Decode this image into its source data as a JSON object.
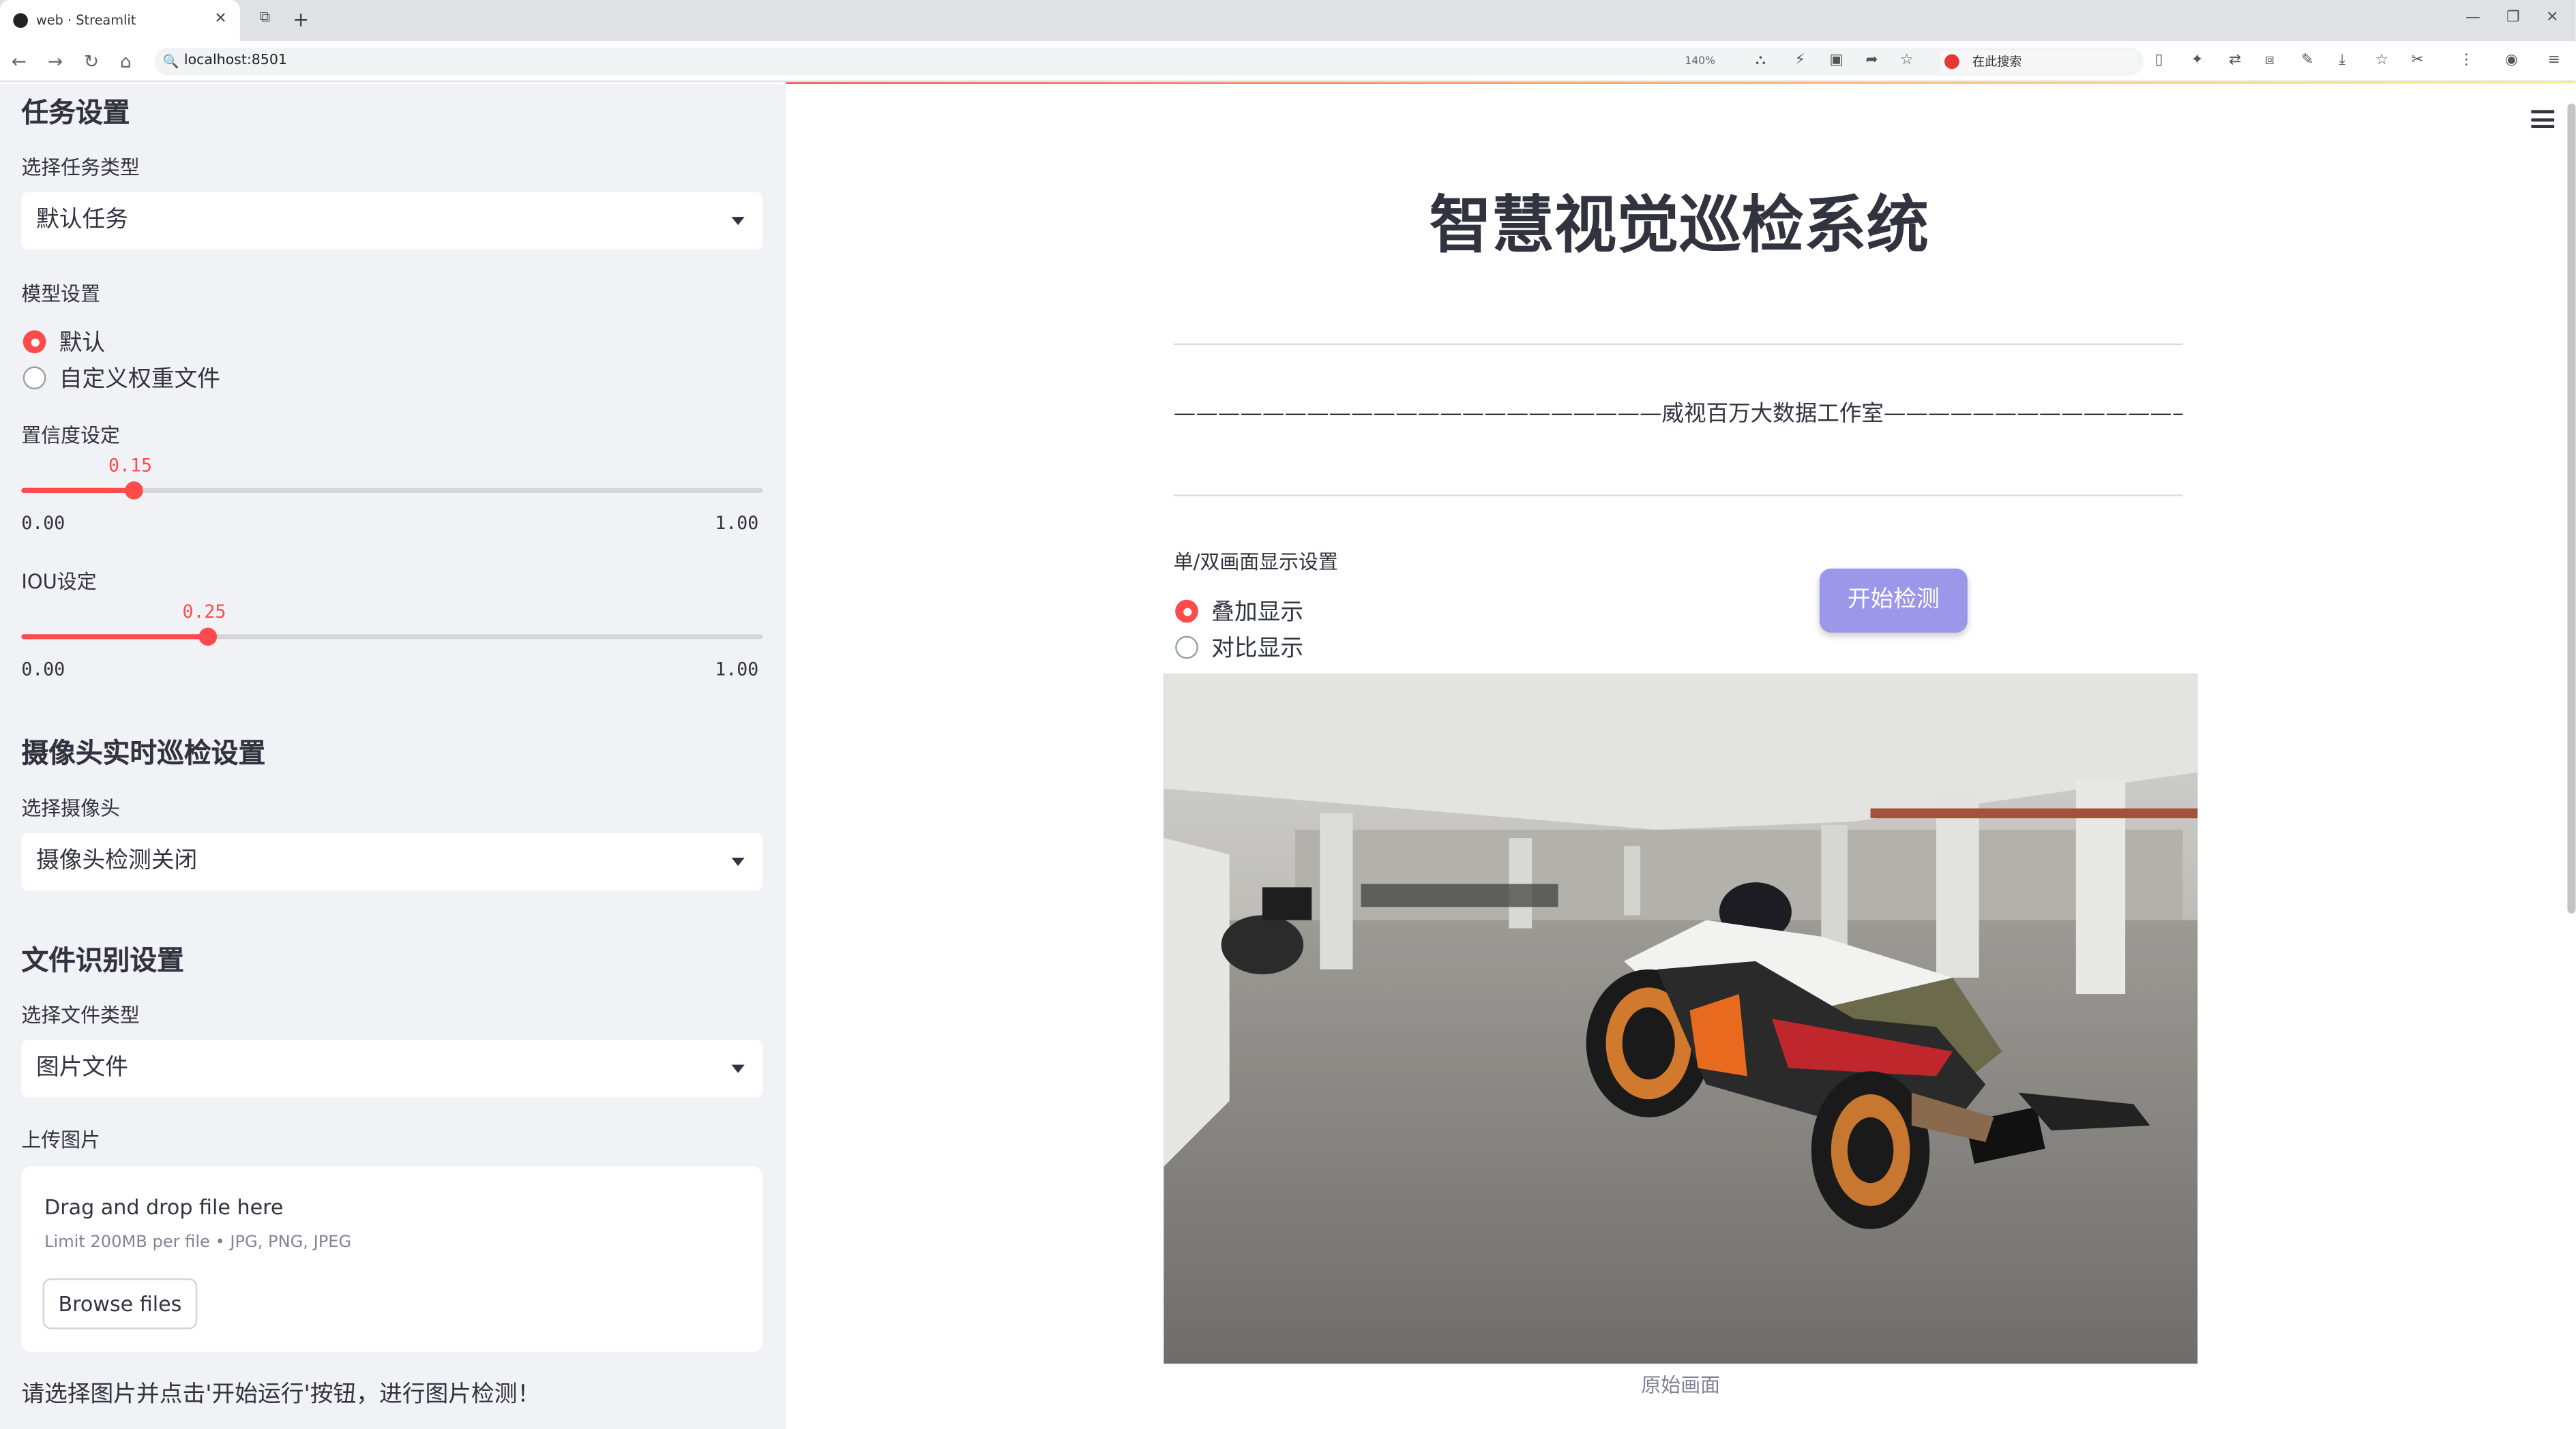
{
  "browser": {
    "tab_title": "web · Streamlit",
    "url": "localhost:8501",
    "zoom": "140%",
    "search_placeholder": "在此搜索"
  },
  "sidebar": {
    "task_section": "任务设置",
    "task_type_label": "选择任务类型",
    "task_type_value": "默认任务",
    "model_label": "模型设置",
    "model_options": [
      "默认",
      "自定义权重文件"
    ],
    "model_selected": 0,
    "conf_label": "置信度设定",
    "conf_value": "0.15",
    "conf_fraction": 0.15,
    "conf_min": "0.00",
    "conf_max": "1.00",
    "iou_label": "IOU设定",
    "iou_value": "0.25",
    "iou_fraction": 0.25,
    "iou_min": "0.00",
    "iou_max": "1.00",
    "camera_section": "摄像头实时巡检设置",
    "camera_label": "选择摄像头",
    "camera_value": "摄像头检测关闭",
    "file_section": "文件识别设置",
    "file_type_label": "选择文件类型",
    "file_type_value": "图片文件",
    "upload_label": "上传图片",
    "upload_title": "Drag and drop file here",
    "upload_limit": "Limit 200MB per file • JPG, PNG, JPEG",
    "browse_label": "Browse files",
    "hint": "请选择图片并点击'开始运行'按钮，进行图片检测！"
  },
  "main": {
    "title": "智慧视觉巡检系统",
    "studio_line": "——————————————————————威视百万大数据工作室———————————————————————",
    "display_label": "单/双画面显示设置",
    "display_options": [
      "叠加显示",
      "对比显示"
    ],
    "display_selected": 0,
    "start_button": "开始检测",
    "image_caption": "原始画面"
  },
  "colors": {
    "accent": "#ff4b4b",
    "sidebar_bg": "#f0f2f6",
    "button_bg": "#9c97e8"
  }
}
